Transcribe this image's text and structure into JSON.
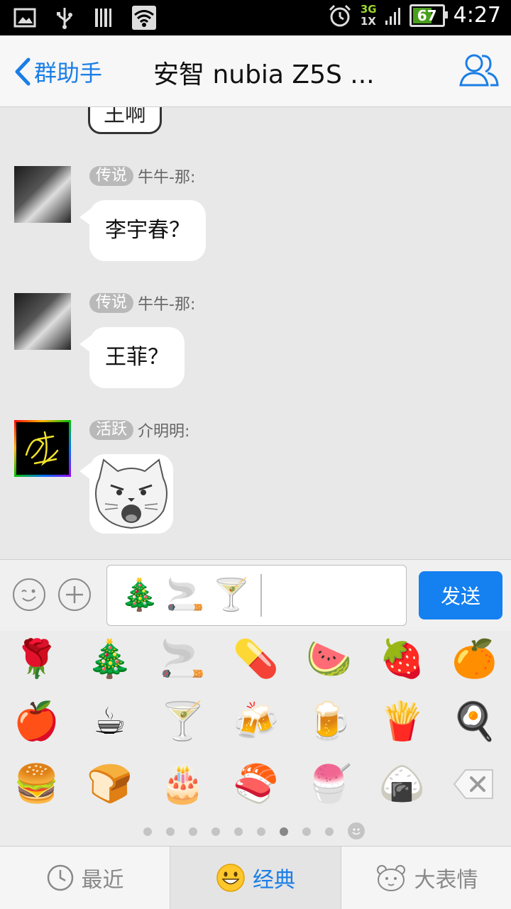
{
  "status_bar": {
    "network_top": "3G",
    "network_bottom": "1X",
    "battery": "67",
    "time": "4:27"
  },
  "header": {
    "back_label": "群助手",
    "title": "安智 nubia Z5S ..."
  },
  "chat": {
    "previous_bubble_text": "王啊",
    "messages": [
      {
        "badge": "传说",
        "sender": "牛牛-那:",
        "text": "李宇春？"
      },
      {
        "badge": "传说",
        "sender": "牛牛-那:",
        "text": "王菲？"
      },
      {
        "badge": "活跃",
        "sender": "介明明:",
        "text": ""
      }
    ]
  },
  "input": {
    "draft_emojis": [
      "🎄",
      "🚬",
      "🍸"
    ],
    "send_label": "发送"
  },
  "emoji_panel": {
    "rows": [
      [
        "🌹",
        "🎄",
        "🚬",
        "💊",
        "🍉",
        "🍓",
        "🍊"
      ],
      [
        "🍎",
        "☕",
        "🍸",
        "🍻",
        "🍺",
        "🍟",
        "🍳"
      ],
      [
        "🍔",
        "🍞",
        "🎂",
        "🍣",
        "🍧",
        "🍙"
      ]
    ],
    "page_count": 9,
    "active_page": 7
  },
  "tabs": {
    "recent": "最近",
    "classic": "经典",
    "big": "大表情"
  },
  "colors": {
    "accent": "#1580f0",
    "chat_bg": "#e8e8e8",
    "badge_bg": "#b9b9b9"
  }
}
